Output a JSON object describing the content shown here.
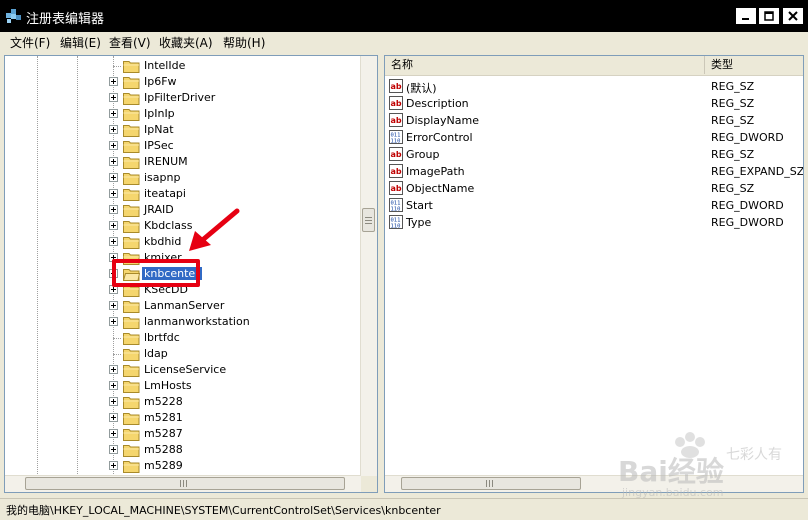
{
  "window": {
    "title": "注册表编辑器"
  },
  "menu": [
    {
      "label": "文件(F)"
    },
    {
      "label": "编辑(E)"
    },
    {
      "label": "查看(V)"
    },
    {
      "label": "收藏夹(A)"
    },
    {
      "label": "帮助(H)"
    }
  ],
  "tree": {
    "items": [
      {
        "label": "IntelIde",
        "expandable": false
      },
      {
        "label": "Ip6Fw",
        "expandable": true
      },
      {
        "label": "IpFilterDriver",
        "expandable": true
      },
      {
        "label": "IpInIp",
        "expandable": true
      },
      {
        "label": "IpNat",
        "expandable": true
      },
      {
        "label": "IPSec",
        "expandable": true
      },
      {
        "label": "IRENUM",
        "expandable": true
      },
      {
        "label": "isapnp",
        "expandable": true
      },
      {
        "label": "iteatapi",
        "expandable": true
      },
      {
        "label": "JRAID",
        "expandable": true
      },
      {
        "label": "Kbdclass",
        "expandable": true
      },
      {
        "label": "kbdhid",
        "expandable": true
      },
      {
        "label": "kmixer",
        "expandable": true
      },
      {
        "label": "knbcenter",
        "expandable": true,
        "selected": true
      },
      {
        "label": "KSecDD",
        "expandable": true
      },
      {
        "label": "LanmanServer",
        "expandable": true
      },
      {
        "label": "lanmanworkstation",
        "expandable": true
      },
      {
        "label": "lbrtfdc",
        "expandable": false
      },
      {
        "label": "ldap",
        "expandable": false
      },
      {
        "label": "LicenseService",
        "expandable": true
      },
      {
        "label": "LmHosts",
        "expandable": true
      },
      {
        "label": "m5228",
        "expandable": true
      },
      {
        "label": "m5281",
        "expandable": true
      },
      {
        "label": "m5287",
        "expandable": true
      },
      {
        "label": "m5288",
        "expandable": true
      },
      {
        "label": "m5289",
        "expandable": true
      }
    ]
  },
  "list": {
    "columns": [
      {
        "label": "名称"
      },
      {
        "label": "类型"
      }
    ],
    "rows": [
      {
        "name": "(默认)",
        "type": "REG_SZ",
        "icon": "string-value-icon"
      },
      {
        "name": "Description",
        "type": "REG_SZ",
        "icon": "string-value-icon"
      },
      {
        "name": "DisplayName",
        "type": "REG_SZ",
        "icon": "string-value-icon"
      },
      {
        "name": "ErrorControl",
        "type": "REG_DWORD",
        "icon": "binary-value-icon"
      },
      {
        "name": "Group",
        "type": "REG_SZ",
        "icon": "string-value-icon"
      },
      {
        "name": "ImagePath",
        "type": "REG_EXPAND_SZ",
        "icon": "string-value-icon"
      },
      {
        "name": "ObjectName",
        "type": "REG_SZ",
        "icon": "string-value-icon"
      },
      {
        "name": "Start",
        "type": "REG_DWORD",
        "icon": "binary-value-icon"
      },
      {
        "name": "Type",
        "type": "REG_DWORD",
        "icon": "binary-value-icon"
      }
    ]
  },
  "statusbar": {
    "path": "我的电脑\\HKEY_LOCAL_MACHINE\\SYSTEM\\CurrentControlSet\\Services\\knbcenter"
  },
  "watermark": {
    "logo": "Bai经验",
    "url": "jingyan.baidu.com",
    "author": "七彩人有"
  },
  "colors": {
    "titlebar": "#000000",
    "selection": "#316ac5",
    "highlight_box": "#e60012",
    "annotation_arrow": "#e60012",
    "list_background": "#ffffff"
  }
}
